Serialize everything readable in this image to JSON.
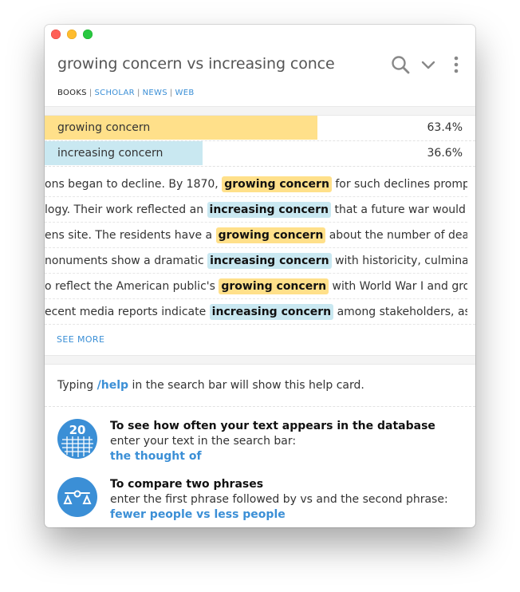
{
  "search": {
    "query": "growing concern vs increasing conce"
  },
  "tabs": [
    {
      "label": "BOOKS",
      "active": true
    },
    {
      "label": "SCHOLAR",
      "active": false
    },
    {
      "label": "NEWS",
      "active": false
    },
    {
      "label": "WEB",
      "active": false
    }
  ],
  "comparison": [
    {
      "phrase": "growing concern",
      "share": 0.634,
      "percent_text": "63.4%",
      "color": "#ffe08a"
    },
    {
      "phrase": "increasing concern",
      "share": 0.366,
      "percent_text": "36.6%",
      "color": "#c9e8f1"
    }
  ],
  "examples": [
    {
      "before": "ons began to decline. By 1870, ",
      "phrase": "growing concern",
      "after": " for such declines prompted fi",
      "kind": "growing"
    },
    {
      "before": "logy. Their work reflected an ",
      "phrase": "increasing concern",
      "after": " that a future war would exer",
      "kind": "increasing"
    },
    {
      "before": "ens site. The residents have a ",
      "phrase": "growing concern",
      "after": " about the number of deaths a",
      "kind": "growing"
    },
    {
      "before": "nonuments show a dramatic ",
      "phrase": "increasing concern",
      "after": " with historicity, culminating",
      "kind": "increasing"
    },
    {
      "before": "o reflect the American public's ",
      "phrase": "growing concern",
      "after": " with World War I and growing",
      "kind": "growing"
    },
    {
      "before": "ecent media reports indicate ",
      "phrase": "increasing concern",
      "after": " among stakeholders, as mas",
      "kind": "increasing"
    }
  ],
  "see_more_label": "SEE MORE",
  "help": {
    "intro_before": "Typing ",
    "intro_cmd": "/help",
    "intro_after": " in the search bar will show this help card.",
    "items": [
      {
        "title": "To see how often your text appears in the database",
        "instruction": "enter your text in the search bar:",
        "example": "the thought of",
        "icon": "frequency-chart-icon",
        "icon_text": "20"
      },
      {
        "title": "To compare two phrases",
        "instruction": "enter the first phrase followed by vs and the second phrase:",
        "example": "fewer people vs less people",
        "icon": "balance-scale-icon"
      }
    ]
  }
}
